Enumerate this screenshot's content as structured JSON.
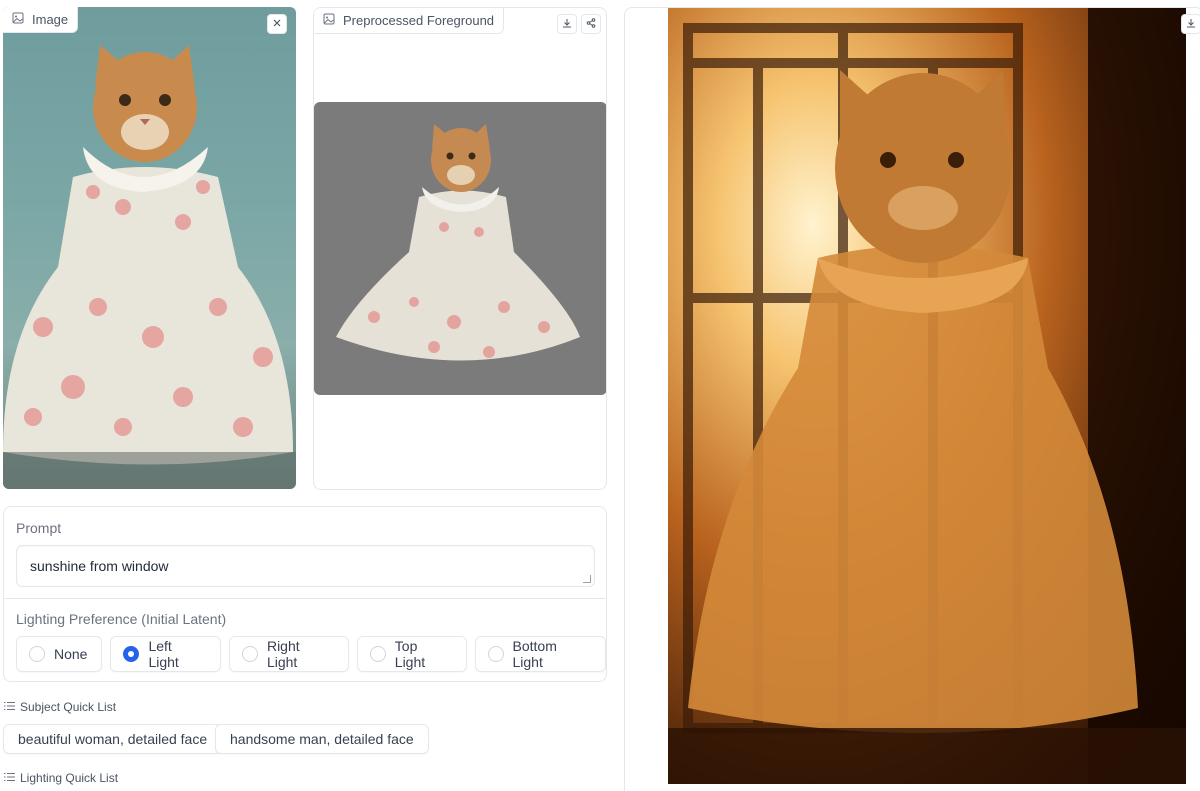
{
  "image_panel": {
    "label": "Image",
    "icon": "image-icon",
    "close_icon": "close-icon"
  },
  "preprocessed_panel": {
    "label": "Preprocessed Foreground",
    "icon": "image-icon",
    "download_icon": "download-icon",
    "share_icon": "share-icon"
  },
  "output_panel": {
    "download_icon": "download-icon"
  },
  "prompt": {
    "label": "Prompt",
    "value": "sunshine from window"
  },
  "lighting_preference": {
    "label": "Lighting Preference (Initial Latent)",
    "options": [
      {
        "label": "None",
        "selected": false
      },
      {
        "label": "Left Light",
        "selected": true
      },
      {
        "label": "Right Light",
        "selected": false
      },
      {
        "label": "Top Light",
        "selected": false
      },
      {
        "label": "Bottom Light",
        "selected": false
      }
    ]
  },
  "subject_quick_list": {
    "label": "Subject Quick List",
    "items": [
      "beautiful woman, detailed face",
      "handsome man, detailed face"
    ]
  },
  "lighting_quick_list": {
    "label": "Lighting Quick List"
  },
  "colors": {
    "accent": "#2563eb",
    "border": "#e5e7eb"
  }
}
